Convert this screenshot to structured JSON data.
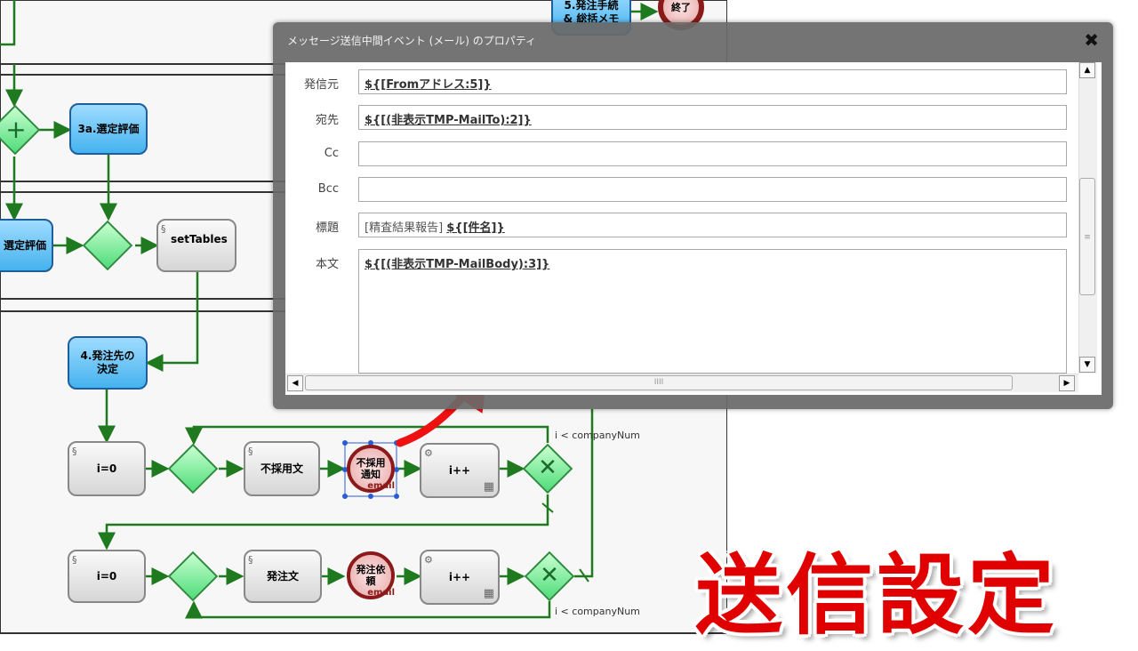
{
  "diagram": {
    "nodes": {
      "task_5": "5.発注手続\n& 総括メモ",
      "end_event": "終了",
      "task_3a": "3a.選定評価",
      "task_select_eval": "選定評価",
      "task_set_tables": "setTables",
      "task_4": "4.発注先の\n決定",
      "task_i0_a": "i=0",
      "task_reject_text": "不採用文",
      "event_reject_notice": "不採用\n通知",
      "event_reject_notice_badge": "email",
      "task_incr_a": "i++",
      "task_i0_b": "i=0",
      "task_order_text": "発注文",
      "event_order_request": "発注依\n頼",
      "event_order_request_badge": "email",
      "task_incr_b": "i++"
    },
    "conditions": {
      "loop_a": "i < companyNum",
      "loop_b": "i < companyNum"
    }
  },
  "dialog": {
    "title": "メッセージ送信中間イベント (メール) のプロパティ",
    "close_glyph": "✖",
    "fields": {
      "from": {
        "label": "発信元",
        "value": "${[Fromアドレス:5]}"
      },
      "to": {
        "label": "宛先",
        "value": "${[(非表示TMP-MailTo):2]}"
      },
      "cc": {
        "label": "Cc",
        "value": ""
      },
      "bcc": {
        "label": "Bcc",
        "value": ""
      },
      "subject": {
        "label": "標題",
        "prefix": "[精査結果報告]",
        "value": "${[件名]}"
      },
      "body": {
        "label": "本文",
        "value": "${[(非表示TMP-MailBody):3]}"
      }
    },
    "scrollbar": {
      "up": "▲",
      "down": "▼",
      "left": "◀",
      "right": "▶",
      "grip_v": "≡",
      "grip_h": "IIII"
    }
  },
  "overlay": {
    "caption": "送信設定",
    "caption_color": "#e00000"
  },
  "colors": {
    "flow": "#1f7a1f",
    "task_blue": "#45b2ee",
    "gateway": "#4fdc7a",
    "event_border": "#8b1a1a",
    "selection": "#2a5bd7"
  }
}
